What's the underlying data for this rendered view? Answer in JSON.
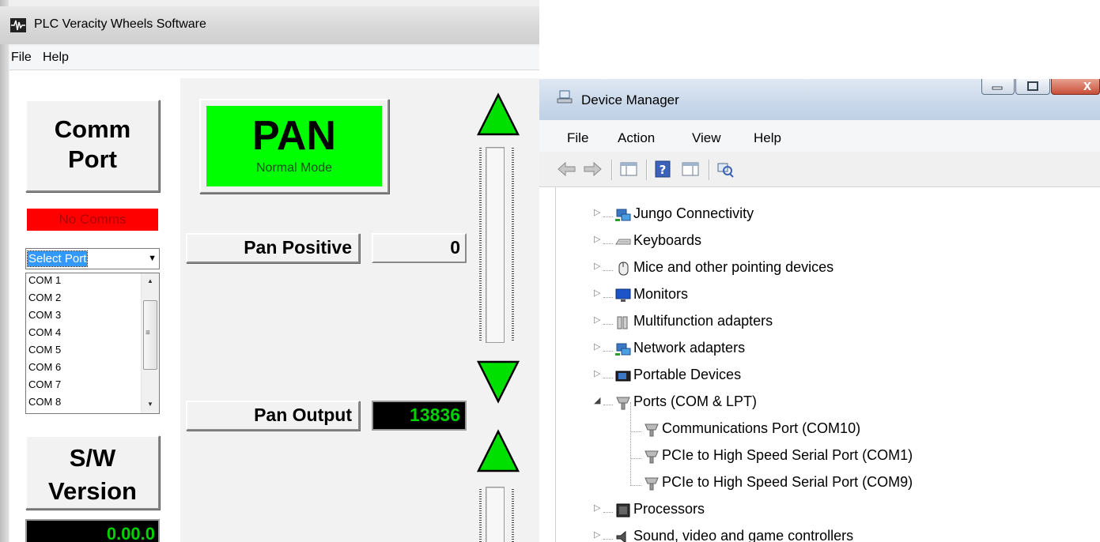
{
  "plc": {
    "title": "PLC Veracity Wheels Software",
    "menu": [
      "File",
      "Help"
    ],
    "comm_port_line1": "Comm",
    "comm_port_line2": "Port",
    "comm_status": "No Comms",
    "port_select_value": "Select Port",
    "ports": [
      "COM 1",
      "COM 2",
      "COM 3",
      "COM 4",
      "COM 5",
      "COM 6",
      "COM 7",
      "COM 8"
    ],
    "sw_line1": "S/W",
    "sw_line2": "Version",
    "sw_version": "0.00.0",
    "pan_title": "PAN",
    "pan_mode": "Normal Mode",
    "pan_positive_label": "Pan Positive",
    "pan_positive_value": "0",
    "pan_output_label": "Pan Output",
    "pan_output_value": "13836"
  },
  "device_manager": {
    "title": "Device Manager",
    "menu": [
      "File",
      "Action",
      "View",
      "Help"
    ],
    "tree": [
      {
        "label": "Jungo Connectivity",
        "icon": "network-icon",
        "state": "collapsed"
      },
      {
        "label": "Keyboards",
        "icon": "keyboard-icon",
        "state": "collapsed"
      },
      {
        "label": "Mice and other pointing devices",
        "icon": "mouse-icon",
        "state": "collapsed"
      },
      {
        "label": "Monitors",
        "icon": "monitor-icon",
        "state": "collapsed"
      },
      {
        "label": "Multifunction adapters",
        "icon": "multifunction-icon",
        "state": "collapsed"
      },
      {
        "label": "Network adapters",
        "icon": "network-icon",
        "state": "collapsed"
      },
      {
        "label": "Portable Devices",
        "icon": "portable-device-icon",
        "state": "collapsed"
      },
      {
        "label": "Ports (COM & LPT)",
        "icon": "port-icon",
        "state": "expanded"
      },
      {
        "label": "Communications Port (COM10)",
        "icon": "port-icon",
        "state": "child"
      },
      {
        "label": "PCIe to High Speed Serial Port (COM1)",
        "icon": "port-icon",
        "state": "child"
      },
      {
        "label": "PCIe to High Speed Serial Port (COM9)",
        "icon": "port-icon",
        "state": "child"
      },
      {
        "label": "Processors",
        "icon": "processor-icon",
        "state": "collapsed"
      },
      {
        "label": "Sound, video and game controllers",
        "icon": "sound-icon",
        "state": "collapsed"
      }
    ]
  }
}
